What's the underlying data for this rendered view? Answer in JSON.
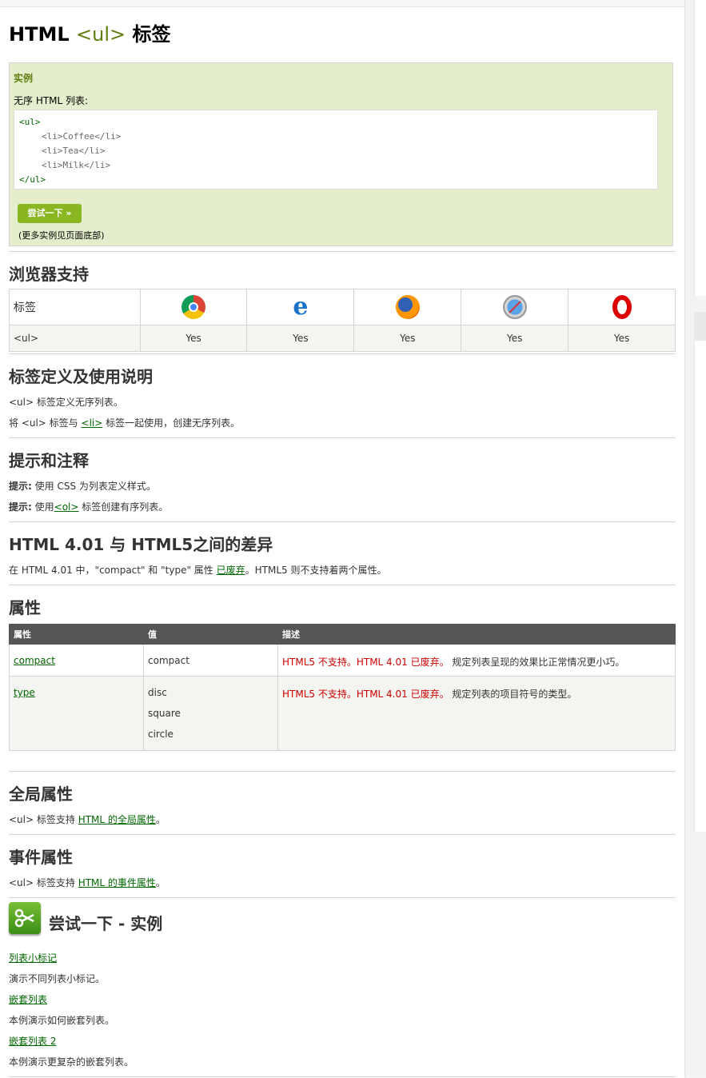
{
  "title": {
    "prefix": "HTML",
    "tag": "<ul>",
    "suffix": "标签"
  },
  "example": {
    "header": "实例",
    "label": "无序 HTML 列表:",
    "code": [
      "<ul>",
      "<li>Coffee</li>",
      "<li>Tea</li>",
      "<li>Milk</li>",
      "</ul>"
    ],
    "try_button": "尝试一下 »",
    "more_note": "(更多实例见页面底部)"
  },
  "browser_support": {
    "heading": "浏览器支持",
    "label_col": "标签",
    "browsers": [
      "chrome-icon",
      "edge-icon",
      "firefox-icon",
      "safari-icon",
      "opera-icon"
    ],
    "row_label": "<ul>",
    "values": [
      "Yes",
      "Yes",
      "Yes",
      "Yes",
      "Yes"
    ]
  },
  "definition": {
    "heading": "标签定义及使用说明",
    "line1": "<ul> 标签定义无序列表。",
    "line2_pre": "将 <ul> 标签与",
    "line2_link": "<li>",
    "line2_post": "标签一起使用，创建无序列表。"
  },
  "tips": {
    "heading": "提示和注释",
    "tip1_label": "提示:",
    "tip1_text": "使用 CSS 为列表定义样式。",
    "tip2_label": "提示:",
    "tip2_pre": "使用",
    "tip2_link": "<ol>",
    "tip2_post": "标签创建有序列表。"
  },
  "diff": {
    "heading": "HTML 4.01 与 HTML5之间的差异",
    "text_pre": "在 HTML 4.01 中，\"compact\" 和 \"type\" 属性",
    "text_link": "已废弃",
    "text_post": "。HTML5 则不支持着两个属性。"
  },
  "attributes": {
    "heading": "属性",
    "columns": [
      "属性",
      "值",
      "描述"
    ],
    "rows": [
      {
        "name": "compact",
        "values": [
          "compact"
        ],
        "red": "HTML5 不支持。HTML 4.01 已废弃。",
        "desc": "规定列表呈现的效果比正常情况更小巧。"
      },
      {
        "name": "type",
        "values": [
          "disc",
          "square",
          "circle"
        ],
        "red": "HTML5 不支持。HTML 4.01 已废弃。",
        "desc": "规定列表的项目符号的类型。"
      }
    ]
  },
  "global": {
    "heading": "全局属性",
    "pre": "<ul> 标签支持",
    "link": "HTML 的全局属性",
    "post": "。"
  },
  "events": {
    "heading": "事件属性",
    "pre": "<ul> 标签支持",
    "link": "HTML 的事件属性",
    "post": "。"
  },
  "tryit": {
    "heading": "尝试一下 - 实例",
    "items": [
      {
        "link": "列表小标记",
        "desc": "演示不同列表小标记。"
      },
      {
        "link": "嵌套列表",
        "desc": "本例演示如何嵌套列表。"
      },
      {
        "link": "嵌套列表 2",
        "desc": "本例演示更复杂的嵌套列表。"
      }
    ]
  }
}
